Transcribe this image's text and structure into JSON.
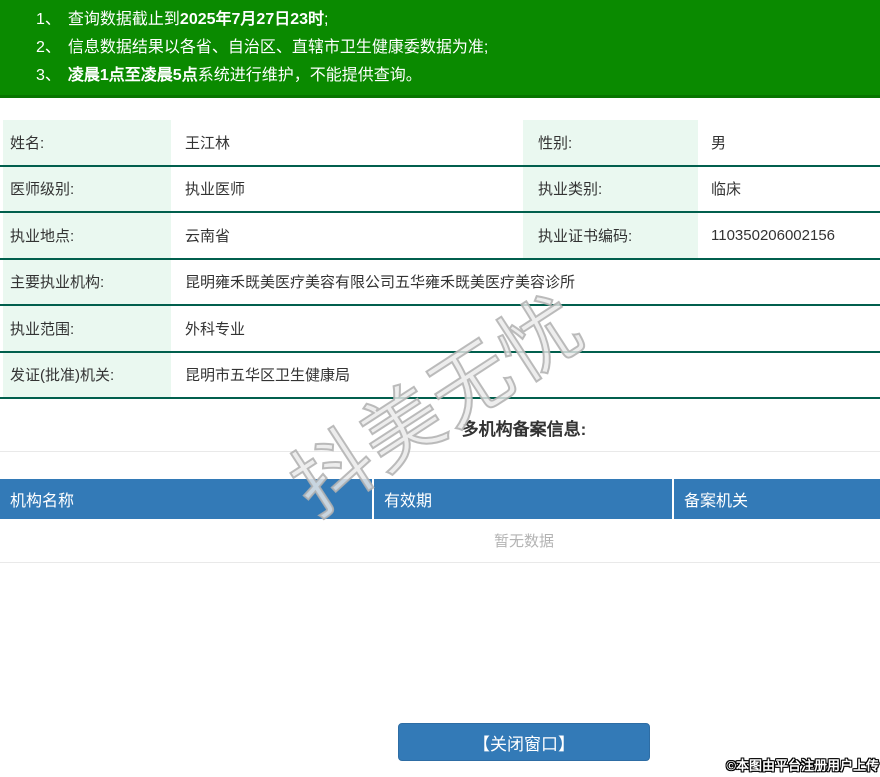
{
  "notice": {
    "items": [
      {
        "num": "1、",
        "pre": "查询数据截止到",
        "bold": "2025年7月27日23时",
        "post": ";"
      },
      {
        "num": "2、",
        "pre": "信息数据结果以各省、自治区、直辖市卫生健康委数据为准;",
        "bold": "",
        "post": ""
      },
      {
        "num": "3、",
        "pre": "",
        "bold": "凌晨1点至凌晨5点",
        "post": "系统进行维护，不能提供查询。"
      }
    ]
  },
  "profile": {
    "rows": [
      {
        "label": "姓名:",
        "value": "王江林",
        "label2": "性别:",
        "value2": "男"
      },
      {
        "label": "医师级别:",
        "value": "执业医师",
        "label2": "执业类别:",
        "value2": "临床"
      },
      {
        "label": "执业地点:",
        "value": "云南省",
        "label2": "执业证书编码:",
        "value2": "110350206002156"
      },
      {
        "label": "主要执业机构:",
        "value": "昆明雍禾既美医疗美容有限公司五华雍禾既美医疗美容诊所"
      },
      {
        "label": "执业范围:",
        "value": "外科专业"
      },
      {
        "label": "发证(批准)机关:",
        "value": "昆明市五华区卫生健康局"
      }
    ]
  },
  "filing": {
    "title": "多机构备案信息:",
    "columns": [
      "机构名称",
      "有效期",
      "备案机关"
    ],
    "empty_text": "暂无数据"
  },
  "close_button_label": "【关闭窗口】",
  "watermark_text": "抖美无忧",
  "copyright_text": "©本图由平台注册用户上传",
  "colors": {
    "notice_green": "#0a8a00",
    "row_divider_green": "#015f4d",
    "label_cell_mint": "#eaf8f0",
    "table_header_blue": "#337ab7",
    "empty_text_gray": "#b3b3b3"
  }
}
